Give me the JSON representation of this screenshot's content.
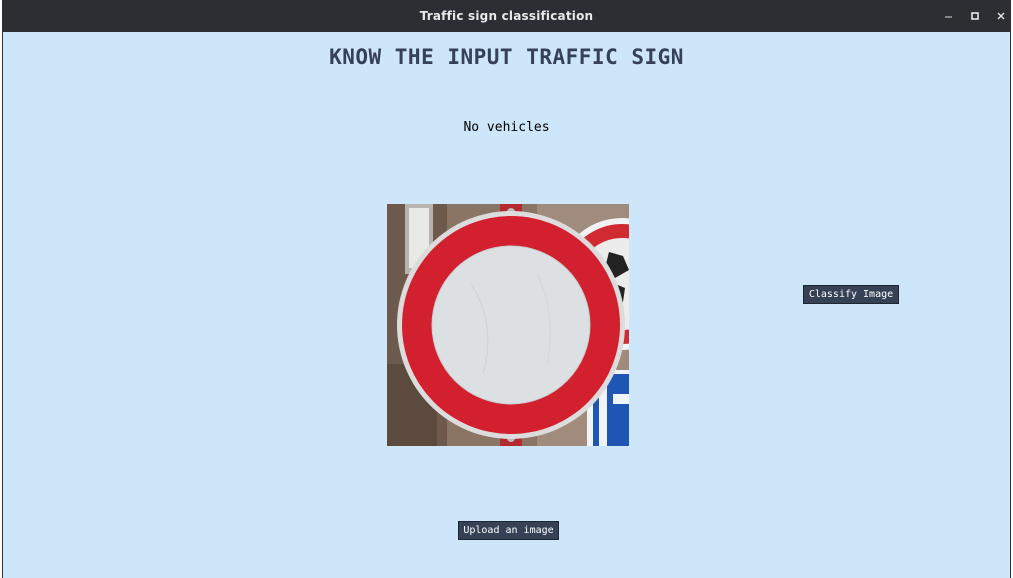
{
  "window": {
    "title": "Traffic sign classification",
    "controls": {
      "minimize": "minimize-icon",
      "maximize": "maximize-icon",
      "close": "close-icon"
    }
  },
  "main": {
    "heading": "KNOW THE INPUT TRAFFIC SIGN",
    "result_label": "No vehicles",
    "classify_button": "Classify Image",
    "upload_button": "Upload an image"
  },
  "colors": {
    "background": "#cde6fa",
    "titlebar": "#2b2e32",
    "heading_text": "#364156",
    "button_bg": "#364156",
    "button_text": "#ffffff",
    "sign_red": "#d3202f"
  }
}
